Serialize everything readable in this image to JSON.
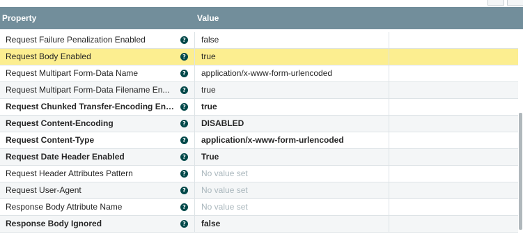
{
  "header": {
    "property_label": "Property",
    "value_label": "Value"
  },
  "help_icon_glyph": "?",
  "rows": [
    {
      "name": "Request Failure Penalization Enabled",
      "value": "false",
      "required": false,
      "empty": false
    },
    {
      "name": "Request Body Enabled",
      "value": "true",
      "required": false,
      "empty": false,
      "selected": true
    },
    {
      "name": "Request Multipart Form-Data Name",
      "value": "application/x-www-form-urlencoded",
      "required": false,
      "empty": false
    },
    {
      "name": "Request Multipart Form-Data Filename En...",
      "value": "true",
      "required": false,
      "empty": false
    },
    {
      "name": "Request Chunked Transfer-Encoding Ena...",
      "value": "true",
      "required": true,
      "empty": false
    },
    {
      "name": "Request Content-Encoding",
      "value": "DISABLED",
      "required": true,
      "empty": false
    },
    {
      "name": "Request Content-Type",
      "value": "application/x-www-form-urlencoded",
      "required": true,
      "empty": false
    },
    {
      "name": "Request Date Header Enabled",
      "value": "True",
      "required": true,
      "empty": false
    },
    {
      "name": "Request Header Attributes Pattern",
      "value": "No value set",
      "required": false,
      "empty": true
    },
    {
      "name": "Request User-Agent",
      "value": "No value set",
      "required": false,
      "empty": true
    },
    {
      "name": "Response Body Attribute Name",
      "value": "No value set",
      "required": false,
      "empty": true
    },
    {
      "name": "Response Body Ignored",
      "value": "false",
      "required": true,
      "empty": false
    }
  ],
  "colors": {
    "header_bg": "#728e9b",
    "selected_row": "#fcee90",
    "help_icon": "#004849",
    "empty_value": "#aab7bd"
  }
}
